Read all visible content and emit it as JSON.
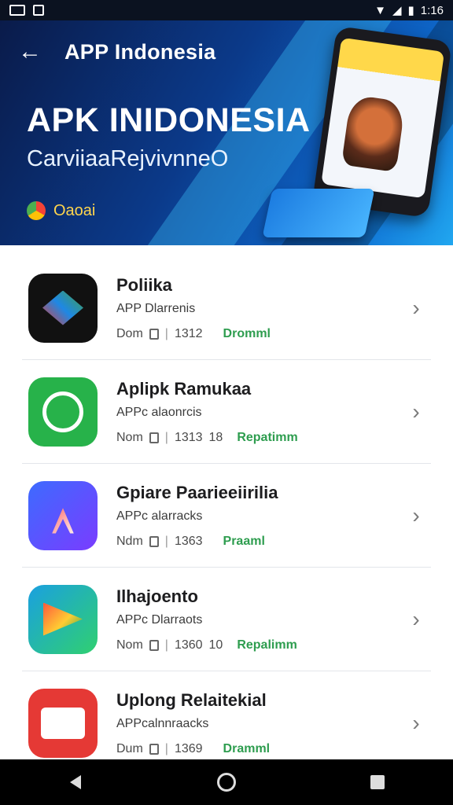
{
  "status_bar": {
    "time": "1:16"
  },
  "header": {
    "title": "APP Indonesia",
    "hero_title": "APK INIDONESIA",
    "hero_subtitle": "CarviiaaRejvivnneO",
    "brand_label": "Oaoai"
  },
  "apps": [
    {
      "name": "Poliika",
      "publisher": "APP Dlarrenis",
      "size": "Dom",
      "count": "1312",
      "extra": "",
      "status": "Dromml"
    },
    {
      "name": "Aplipk Ramukaa",
      "publisher": "APPc alaonrcis",
      "size": "Nom",
      "count": "1313",
      "extra": "18",
      "status": "Repatimm"
    },
    {
      "name": "Gpiare Paarieeiirilia",
      "publisher": "APPc alarracks",
      "size": "Ndm",
      "count": "1363",
      "extra": "",
      "status": "Praaml"
    },
    {
      "name": "Ilhajoento",
      "publisher": "APPc Dlarraots",
      "size": "Nom",
      "count": "1360",
      "extra": "10",
      "status": "Repalimm"
    },
    {
      "name": "Uplong Relaitekial",
      "publisher": "APPcalnnraacks",
      "size": "Dum",
      "count": "1369",
      "extra": "",
      "status": "Dramml"
    }
  ],
  "icons": {
    "status_left": [
      "screen-record-icon",
      "notification-icon"
    ],
    "status_right": [
      "wifi-icon",
      "signal-icon",
      "battery-icon"
    ],
    "nav": [
      "back-nav-icon",
      "home-nav-icon",
      "recents-nav-icon"
    ]
  },
  "colors": {
    "accent_green": "#2e9d4f",
    "banner_dark": "#0a1b4a",
    "banner_light": "#21a7f0"
  }
}
